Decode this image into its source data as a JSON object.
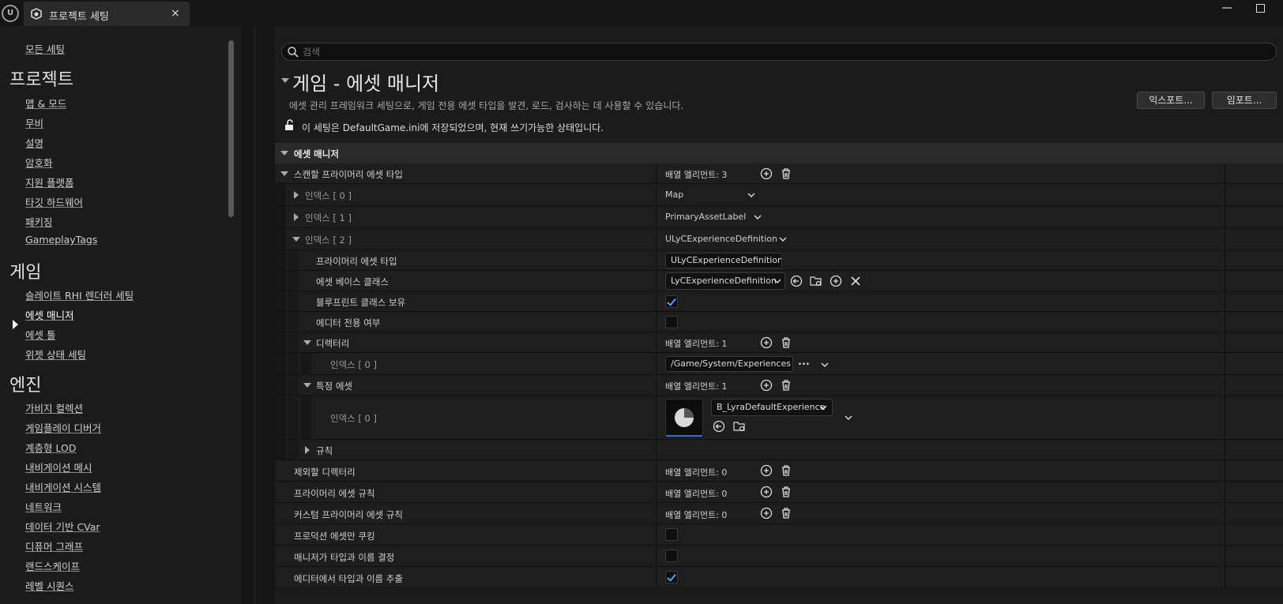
{
  "window": {
    "tab_title": "프로젝트 세팅",
    "close_glyph": "×"
  },
  "sidebar": {
    "all_settings": "모든 세팅",
    "sections": [
      {
        "title": "프로젝트",
        "items": [
          "맵 & 모드",
          "무비",
          "설명",
          "암호화",
          "지원 플랫폼",
          "타깃 하드웨어",
          "패키징",
          "GameplayTags"
        ]
      },
      {
        "title": "게임",
        "items": [
          "슬레이트 RHI 렌더러 세팅",
          "에셋 매니저",
          "에셋 툴",
          "위젯 상태 세팅"
        ]
      },
      {
        "title": "엔진",
        "items": [
          "가비지 컬렉션",
          "게임플레이 디버거",
          "계층형 LOD",
          "내비게이션 메시",
          "내비게이션 시스템",
          "네트워크",
          "데이터 기반 CVar",
          "디퓨머 그래프",
          "랜드스케이프",
          "레벨 시퀀스"
        ]
      }
    ],
    "selected_item": "에셋 매니저"
  },
  "main": {
    "search_placeholder": "검색",
    "title": "게임 - 에셋 매니저",
    "description": "에셋 관리 프레임워크 세팅으로, 게임 전용 에셋 타입을 발견, 로드, 검사하는 데 사용할 수 있습니다.",
    "export_label": "익스포트...",
    "import_label": "임포트...",
    "save_message": "이 세팅은 DefaultGame.ini에 저장되었으며, 현재 쓰기가능한 상태입니다.",
    "category": "에셋 매니저",
    "rows": {
      "primary_types": {
        "label": "스캔할 프라이머리 에셋 타입",
        "value": "배열 엘리먼트: 3"
      },
      "index0": {
        "label": "인덱스 [ 0 ]",
        "value": "Map"
      },
      "index1": {
        "label": "인덱스 [ 1 ]",
        "value": "PrimaryAssetLabel"
      },
      "index2": {
        "label": "인덱스 [ 2 ]",
        "value": "ULyCExperienceDefinition"
      },
      "primary_asset_type": {
        "label": "프라이머리 에셋 타입",
        "value": "ULyCExperienceDefinition"
      },
      "asset_base_class": {
        "label": "에셋 베이스 클래스",
        "value": "LyCExperienceDefinition"
      },
      "has_blueprint": {
        "label": "블루프린트 클래스 보유",
        "checked": true
      },
      "editor_only": {
        "label": "에디터 전용 여부",
        "checked": false
      },
      "directories": {
        "label": "디렉터리",
        "value": "배열 엘리먼트: 1"
      },
      "dir_index0": {
        "label": "인덱스 [ 0 ]",
        "value": "/Game/System/Experiences",
        "more": "..."
      },
      "specific_assets": {
        "label": "특정 에셋",
        "value": "배열 엘리먼트: 1"
      },
      "asset_index0": {
        "label": "인덱스 [ 0 ]",
        "value": "B_LyraDefaultExperience"
      },
      "rules": {
        "label": "규칙"
      },
      "excluded_dirs": {
        "label": "제외할 디렉터리",
        "value": "배열 엘리먼트: 0"
      },
      "primary_rules": {
        "label": "프라이머리 에셋 규칙",
        "value": "배열 엘리먼트: 0"
      },
      "custom_rules": {
        "label": "커스텀 프라이머리 에셋 규칙",
        "value": "배열 엘리먼트: 0"
      },
      "cook_prod_only": {
        "label": "프로덕션 에셋만 쿠킹",
        "checked": false
      },
      "manager_decides": {
        "label": "매니저가 타입과 이름 결정",
        "checked": false
      },
      "editor_extract": {
        "label": "에디터에서 타입과 이름 추출",
        "checked": true
      }
    }
  }
}
